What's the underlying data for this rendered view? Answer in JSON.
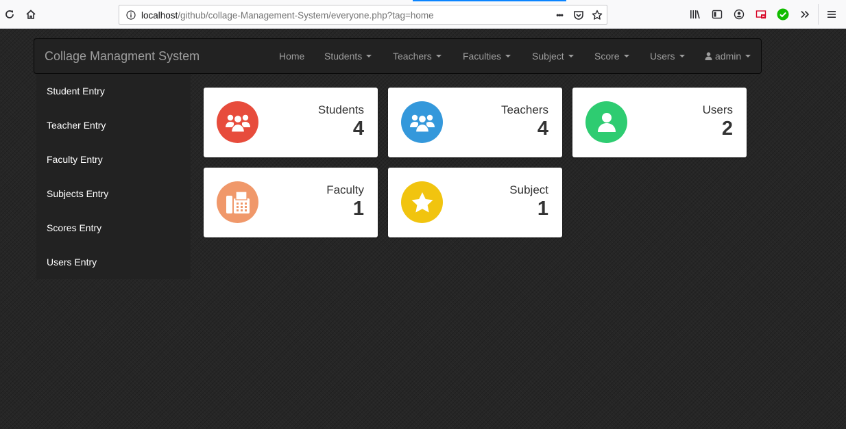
{
  "browser": {
    "url_host": "localhost",
    "url_path": "/github/collage-Management-System/everyone.php?tag=home",
    "more_label": "•••"
  },
  "navbar": {
    "brand": "Collage Managment System",
    "items": [
      {
        "label": "Home"
      },
      {
        "label": "Students"
      },
      {
        "label": "Teachers"
      },
      {
        "label": "Faculties"
      },
      {
        "label": "Subject"
      },
      {
        "label": "Score"
      },
      {
        "label": "Users"
      },
      {
        "label": "admin"
      }
    ]
  },
  "sidebar": {
    "items": [
      {
        "label": "Student Entry"
      },
      {
        "label": "Teacher Entry"
      },
      {
        "label": "Faculty Entry"
      },
      {
        "label": "Subjects Entry"
      },
      {
        "label": "Scores Entry"
      },
      {
        "label": "Users Entry"
      }
    ]
  },
  "cards": [
    {
      "label": "Students",
      "value": "4",
      "color": "#e74c3c",
      "icon": "users-group-icon"
    },
    {
      "label": "Teachers",
      "value": "4",
      "color": "#3498db",
      "icon": "users-group-icon"
    },
    {
      "label": "Users",
      "value": "2",
      "color": "#2ecc71",
      "icon": "user-icon"
    },
    {
      "label": "Faculty",
      "value": "1",
      "color": "#f0986a",
      "icon": "fax-icon"
    },
    {
      "label": "Subject",
      "value": "1",
      "color": "#f1c40f",
      "icon": "star-icon"
    }
  ]
}
